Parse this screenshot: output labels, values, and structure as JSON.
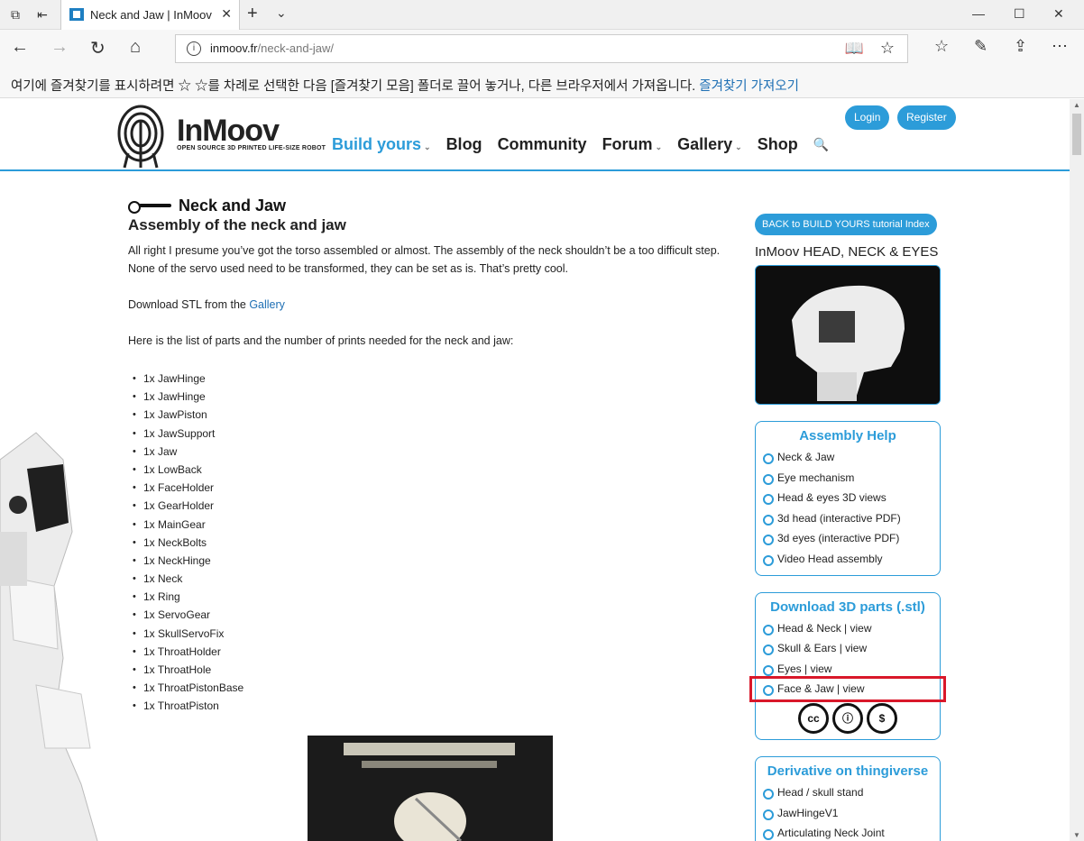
{
  "browser": {
    "tab_title": "Neck and Jaw | InMoov",
    "url_host": "inmoov.fr",
    "url_path": "/neck-and-jaw/",
    "favbar_text": "여기에 즐겨찾기를 표시하려면 ☆ ☆를 차례로 선택한 다음 [즐겨찾기 모음] 폴더로 끌어 놓거나, 다른 브라우저에서 가져옵니다.",
    "favbar_link": "즐겨찾기 가져오기"
  },
  "header": {
    "logo_text": "InMoov",
    "logo_tagline": "OPEN SOURCE 3D PRINTED LIFE-SIZE ROBOT",
    "menu": [
      {
        "label": "Build yours"
      },
      {
        "label": "Blog"
      },
      {
        "label": "Community"
      },
      {
        "label": "Forum"
      },
      {
        "label": "Gallery"
      },
      {
        "label": "Shop"
      }
    ],
    "login_label": "Login",
    "register_label": "Register"
  },
  "main": {
    "title": "Neck and Jaw",
    "subtitle": "Assembly of the neck and jaw",
    "intro": "All right I presume you’ve got the torso assembled or almost. The assembly of the neck shouldn’t be a too difficult step. None of the servo used need to be transformed, they can be set as is. That’s pretty cool.",
    "download_prefix": "Download STL from the ",
    "download_link": "Gallery",
    "list_intro": "Here is the list of parts and the number of prints needed for the neck and jaw:",
    "parts": [
      "1x JawHinge",
      "1x JawHinge",
      "1x JawPiston",
      "1x JawSupport",
      "1x Jaw",
      "1x LowBack",
      "1x FaceHolder",
      "1x GearHolder",
      "1x MainGear",
      "1x NeckBolts",
      "1x NeckHinge",
      "1x Neck",
      "1x Ring",
      "1x ServoGear",
      "1x SkullServoFix",
      "1x ThroatHolder",
      "1x ThroatHole",
      "1x ThroatPistonBase",
      "1x ThroatPiston"
    ]
  },
  "sidebar": {
    "back_button": "BACK to BUILD YOURS tutorial Index",
    "head_title": "InMoov HEAD, NECK & EYES",
    "assembly": {
      "title": "Assembly Help",
      "items": [
        "Neck & Jaw",
        "Eye mechanism",
        "Head & eyes 3D views",
        "3d head (interactive PDF)",
        "3d eyes (interactive PDF)",
        "Video Head assembly"
      ]
    },
    "download": {
      "title": "Download 3D parts (.stl)",
      "items": [
        "Head & Neck | view",
        "Skull & Ears | view",
        "Eyes | view",
        "Face & Jaw | view"
      ]
    },
    "license_icons": [
      "cc",
      "by",
      "nc"
    ],
    "derivative": {
      "title": "Derivative on thingiverse",
      "items": [
        "Head / skull stand",
        "JawHingeV1",
        "Articulating Neck Joint"
      ]
    }
  },
  "colors": {
    "accent": "#2c9cd9",
    "highlight": "#d9182a"
  }
}
